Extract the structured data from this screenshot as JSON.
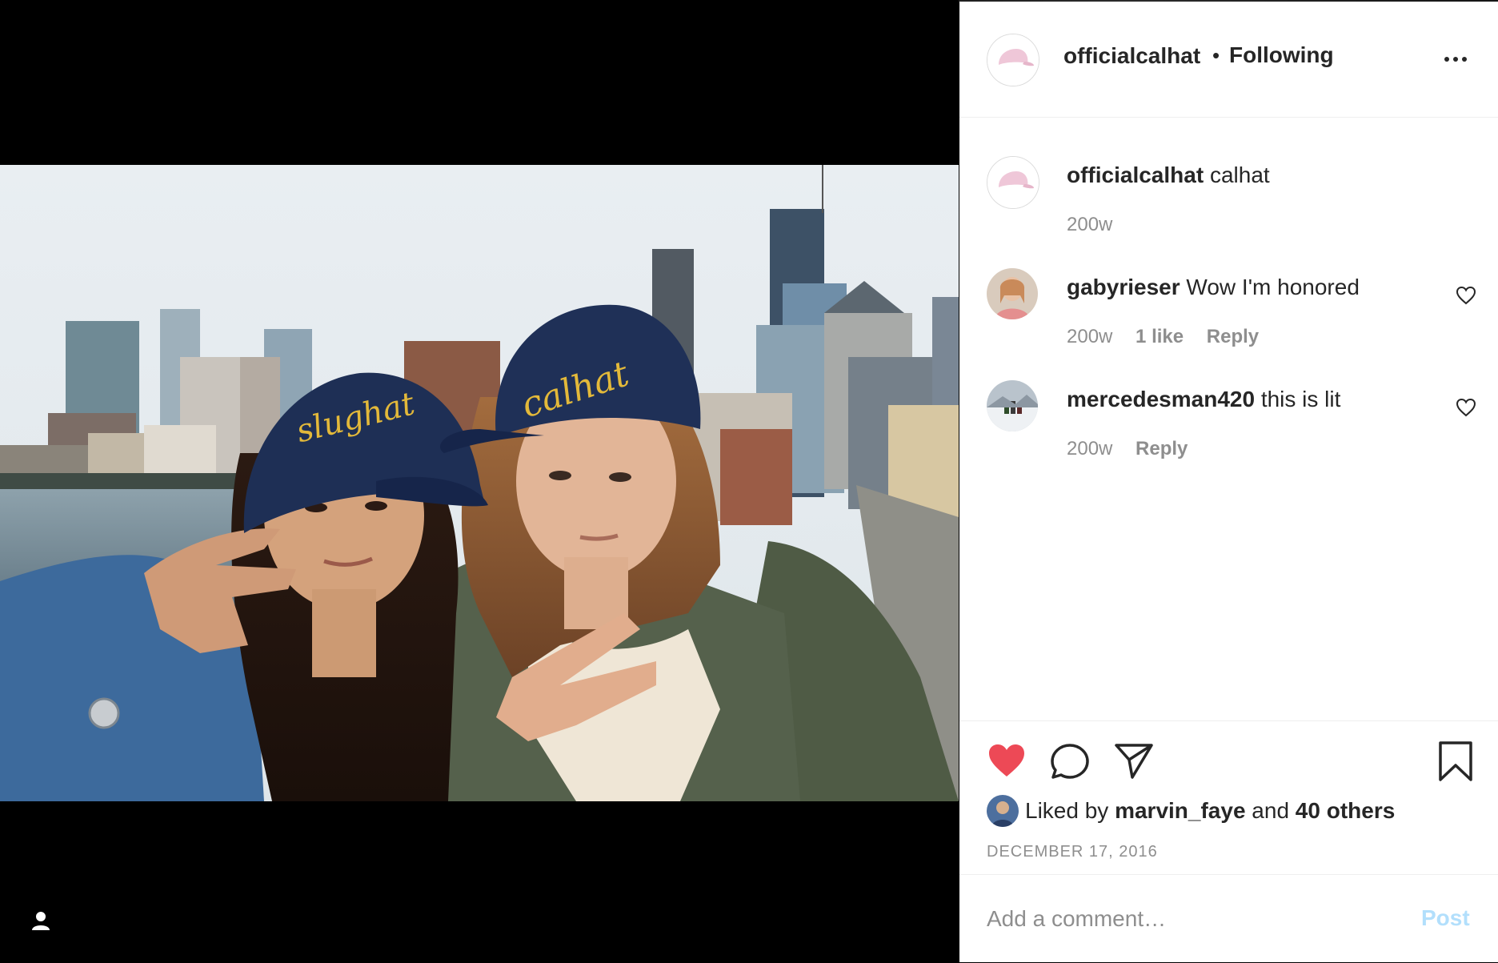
{
  "post": {
    "username": "officialcalhat",
    "follow_dot": "•",
    "follow_status": "Following",
    "caption_user": "officialcalhat",
    "caption_text": "calhat",
    "caption_age": "200w"
  },
  "photo": {
    "hat_left_text": "slughat",
    "hat_right_text": "calhat"
  },
  "comments": [
    {
      "user": "gabyrieser",
      "text": "Wow I'm honored",
      "age": "200w",
      "likes": "1 like",
      "reply": "Reply"
    },
    {
      "user": "mercedesman420",
      "text": "this is lit",
      "age": "200w",
      "reply": "Reply"
    }
  ],
  "actions": {
    "liked_by_prefix": "Liked by",
    "liked_by_user": "marvin_faye",
    "liked_by_and": "and",
    "liked_by_others": "40 others",
    "date": "DECEMBER 17, 2016",
    "heart_color": "#ed4956"
  },
  "comment_box": {
    "placeholder": "Add a comment…",
    "post_label": "Post",
    "post_color": "#b2dffc"
  },
  "icons": [
    "user-tag-icon",
    "more-options-icon",
    "heart-icon",
    "comment-icon",
    "share-icon",
    "bookmark-icon"
  ]
}
